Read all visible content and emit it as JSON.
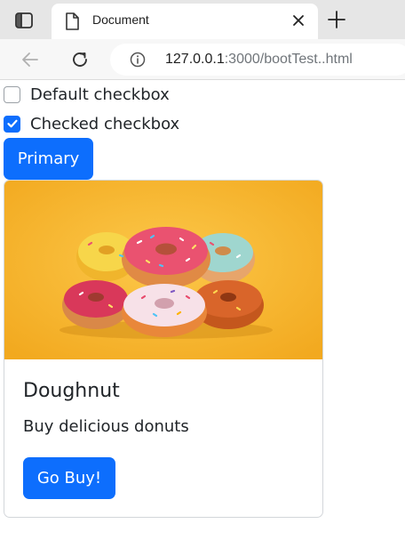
{
  "browser": {
    "tab_title": "Document",
    "url_host": "127.0.0.1",
    "url_path": ":3000/bootTest..html"
  },
  "form": {
    "checkbox_default_label": "Default checkbox",
    "checkbox_default_checked": false,
    "checkbox_checked_label": "Checked checkbox",
    "checkbox_checked_checked": true,
    "primary_button_label": "Primary"
  },
  "card": {
    "image_subject": "stack of colorful sprinkled doughnuts on yellow background",
    "title": "Doughnut",
    "text": "Buy delicious donuts",
    "button_label": "Go Buy!"
  },
  "colors": {
    "primary": "#0d6efd",
    "image_background": "#f6b730"
  },
  "icons": {
    "sidebar": "sidebar-toggle-icon",
    "tab": "document-icon",
    "close": "close-icon",
    "new_tab": "plus-icon",
    "back": "back-arrow-icon",
    "reload": "reload-icon",
    "site_info": "info-icon",
    "check": "checkmark-icon"
  }
}
